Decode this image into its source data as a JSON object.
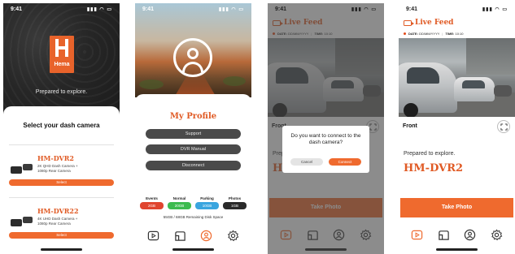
{
  "status_time": "9:41",
  "screen1": {
    "logo_text": "Hema",
    "tagline": "Prepared to explore.",
    "sheet_title": "Select your dash camera",
    "cameras": [
      {
        "name": "HM-DVR2",
        "desc_line1": "2K QHD Dash Camera +",
        "desc_line2": "1080p Rear Camera",
        "button": "Select"
      },
      {
        "name": "HM-DVR22",
        "desc_line1": "4K UHD Dash Camera +",
        "desc_line2": "1080p Rear Camera",
        "button": "Select"
      }
    ]
  },
  "screen2": {
    "title": "My Profile",
    "buttons": [
      "Support",
      "DVR Manual",
      "Disconnect"
    ],
    "stats": [
      {
        "label": "Events",
        "value": "2GB",
        "color": "#e0452f"
      },
      {
        "label": "Normal",
        "value": "20GB",
        "color": "#3dbb4f"
      },
      {
        "label": "Parking",
        "value": "10GB",
        "color": "#3aa5df"
      },
      {
        "label": "Photos",
        "value": "1GB",
        "color": "#2a2a2a"
      }
    ],
    "disk_text": "55GB / 68GB Remaining Disk Space"
  },
  "live": {
    "title": "Live Feed",
    "date_label": "DATE:",
    "date_value": "DD/MM/YYYY",
    "time_label": "TIME:",
    "time_value": "10:10",
    "camera_label": "Front",
    "prepared_text": "Prepared to explore.",
    "model": "HM-DVR2",
    "photo_button": "Take Photo"
  },
  "dialog": {
    "message": "Do you want to connect to the dash camera?",
    "cancel": "Cancel",
    "connect": "Connect"
  },
  "colors": {
    "accent": "#ef6a2e",
    "dark_pill": "#4a4a4a"
  },
  "tab_icons": [
    "video-icon",
    "map-icon",
    "profile-icon",
    "settings-icon"
  ]
}
